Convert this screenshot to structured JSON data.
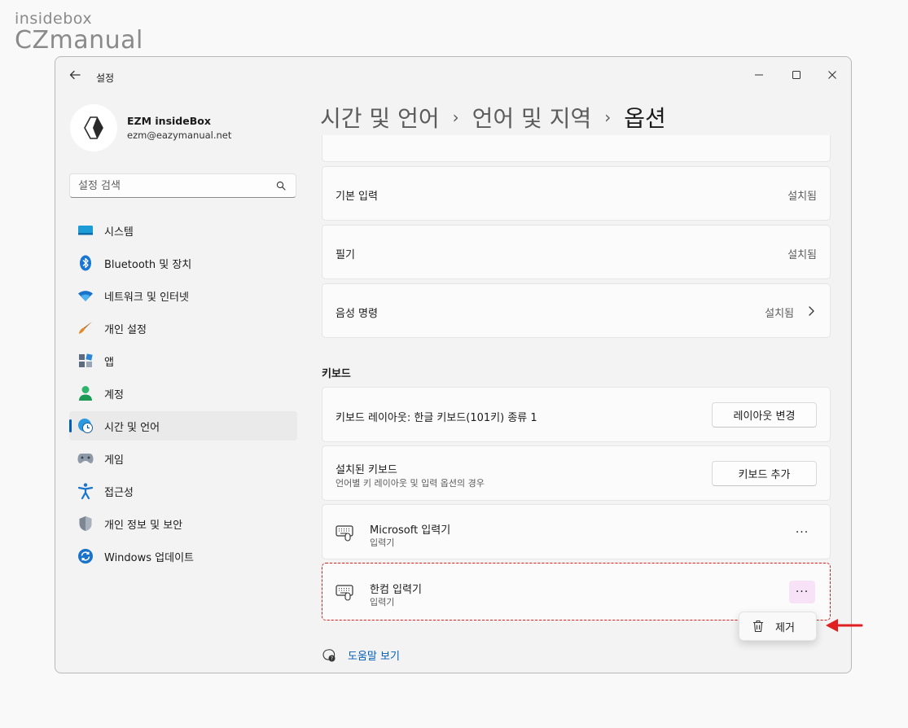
{
  "watermark": {
    "top": "insidebox",
    "bottom": "CZmanual"
  },
  "window": {
    "title": "설정"
  },
  "profile": {
    "name": "EZM insideBox",
    "email": "ezm@eazymanual.net"
  },
  "search": {
    "placeholder": "설정 검색"
  },
  "nav": {
    "items": [
      {
        "label": "시스템",
        "icon": "system-icon"
      },
      {
        "label": "Bluetooth 및 장치",
        "icon": "bluetooth-icon"
      },
      {
        "label": "네트워크 및 인터넷",
        "icon": "wifi-icon"
      },
      {
        "label": "개인 설정",
        "icon": "brush-icon"
      },
      {
        "label": "앱",
        "icon": "apps-icon"
      },
      {
        "label": "계정",
        "icon": "account-icon"
      },
      {
        "label": "시간 및 언어",
        "icon": "clock-globe-icon",
        "active": true
      },
      {
        "label": "게임",
        "icon": "gamepad-icon"
      },
      {
        "label": "접근성",
        "icon": "accessibility-icon"
      },
      {
        "label": "개인 정보 및 보안",
        "icon": "shield-icon"
      },
      {
        "label": "Windows 업데이트",
        "icon": "update-icon"
      }
    ]
  },
  "breadcrumb": {
    "level1": "시간 및 언어",
    "level2": "언어 및 지역",
    "current": "옵션",
    "separator": "›"
  },
  "rows": {
    "basic_input": {
      "label": "기본 입력",
      "value": "설치됨"
    },
    "handwriting": {
      "label": "필기",
      "value": "설치됨"
    },
    "voice": {
      "label": "음성 명령",
      "value": "설치됨"
    }
  },
  "keyboard": {
    "section_title": "키보드",
    "layout": {
      "label": "키보드 레이아웃: 한글 키보드(101키) 종류 1",
      "button": "레이아웃 변경"
    },
    "installed": {
      "label": "설치된 키보드",
      "sub": "언어별 키 레이아웃 및 입력 옵션의 경우",
      "button": "키보드 추가"
    },
    "items": [
      {
        "name": "Microsoft 입력기",
        "type": "입력기"
      },
      {
        "name": "한컴 입력기",
        "type": "입력기"
      }
    ],
    "more_label": "···"
  },
  "context_menu": {
    "remove": "제거"
  },
  "help": {
    "label": "도움말 보기"
  },
  "colors": {
    "accent": "#005fb8",
    "highlight": "#d42020",
    "more_hover": "#f8e2f7"
  }
}
